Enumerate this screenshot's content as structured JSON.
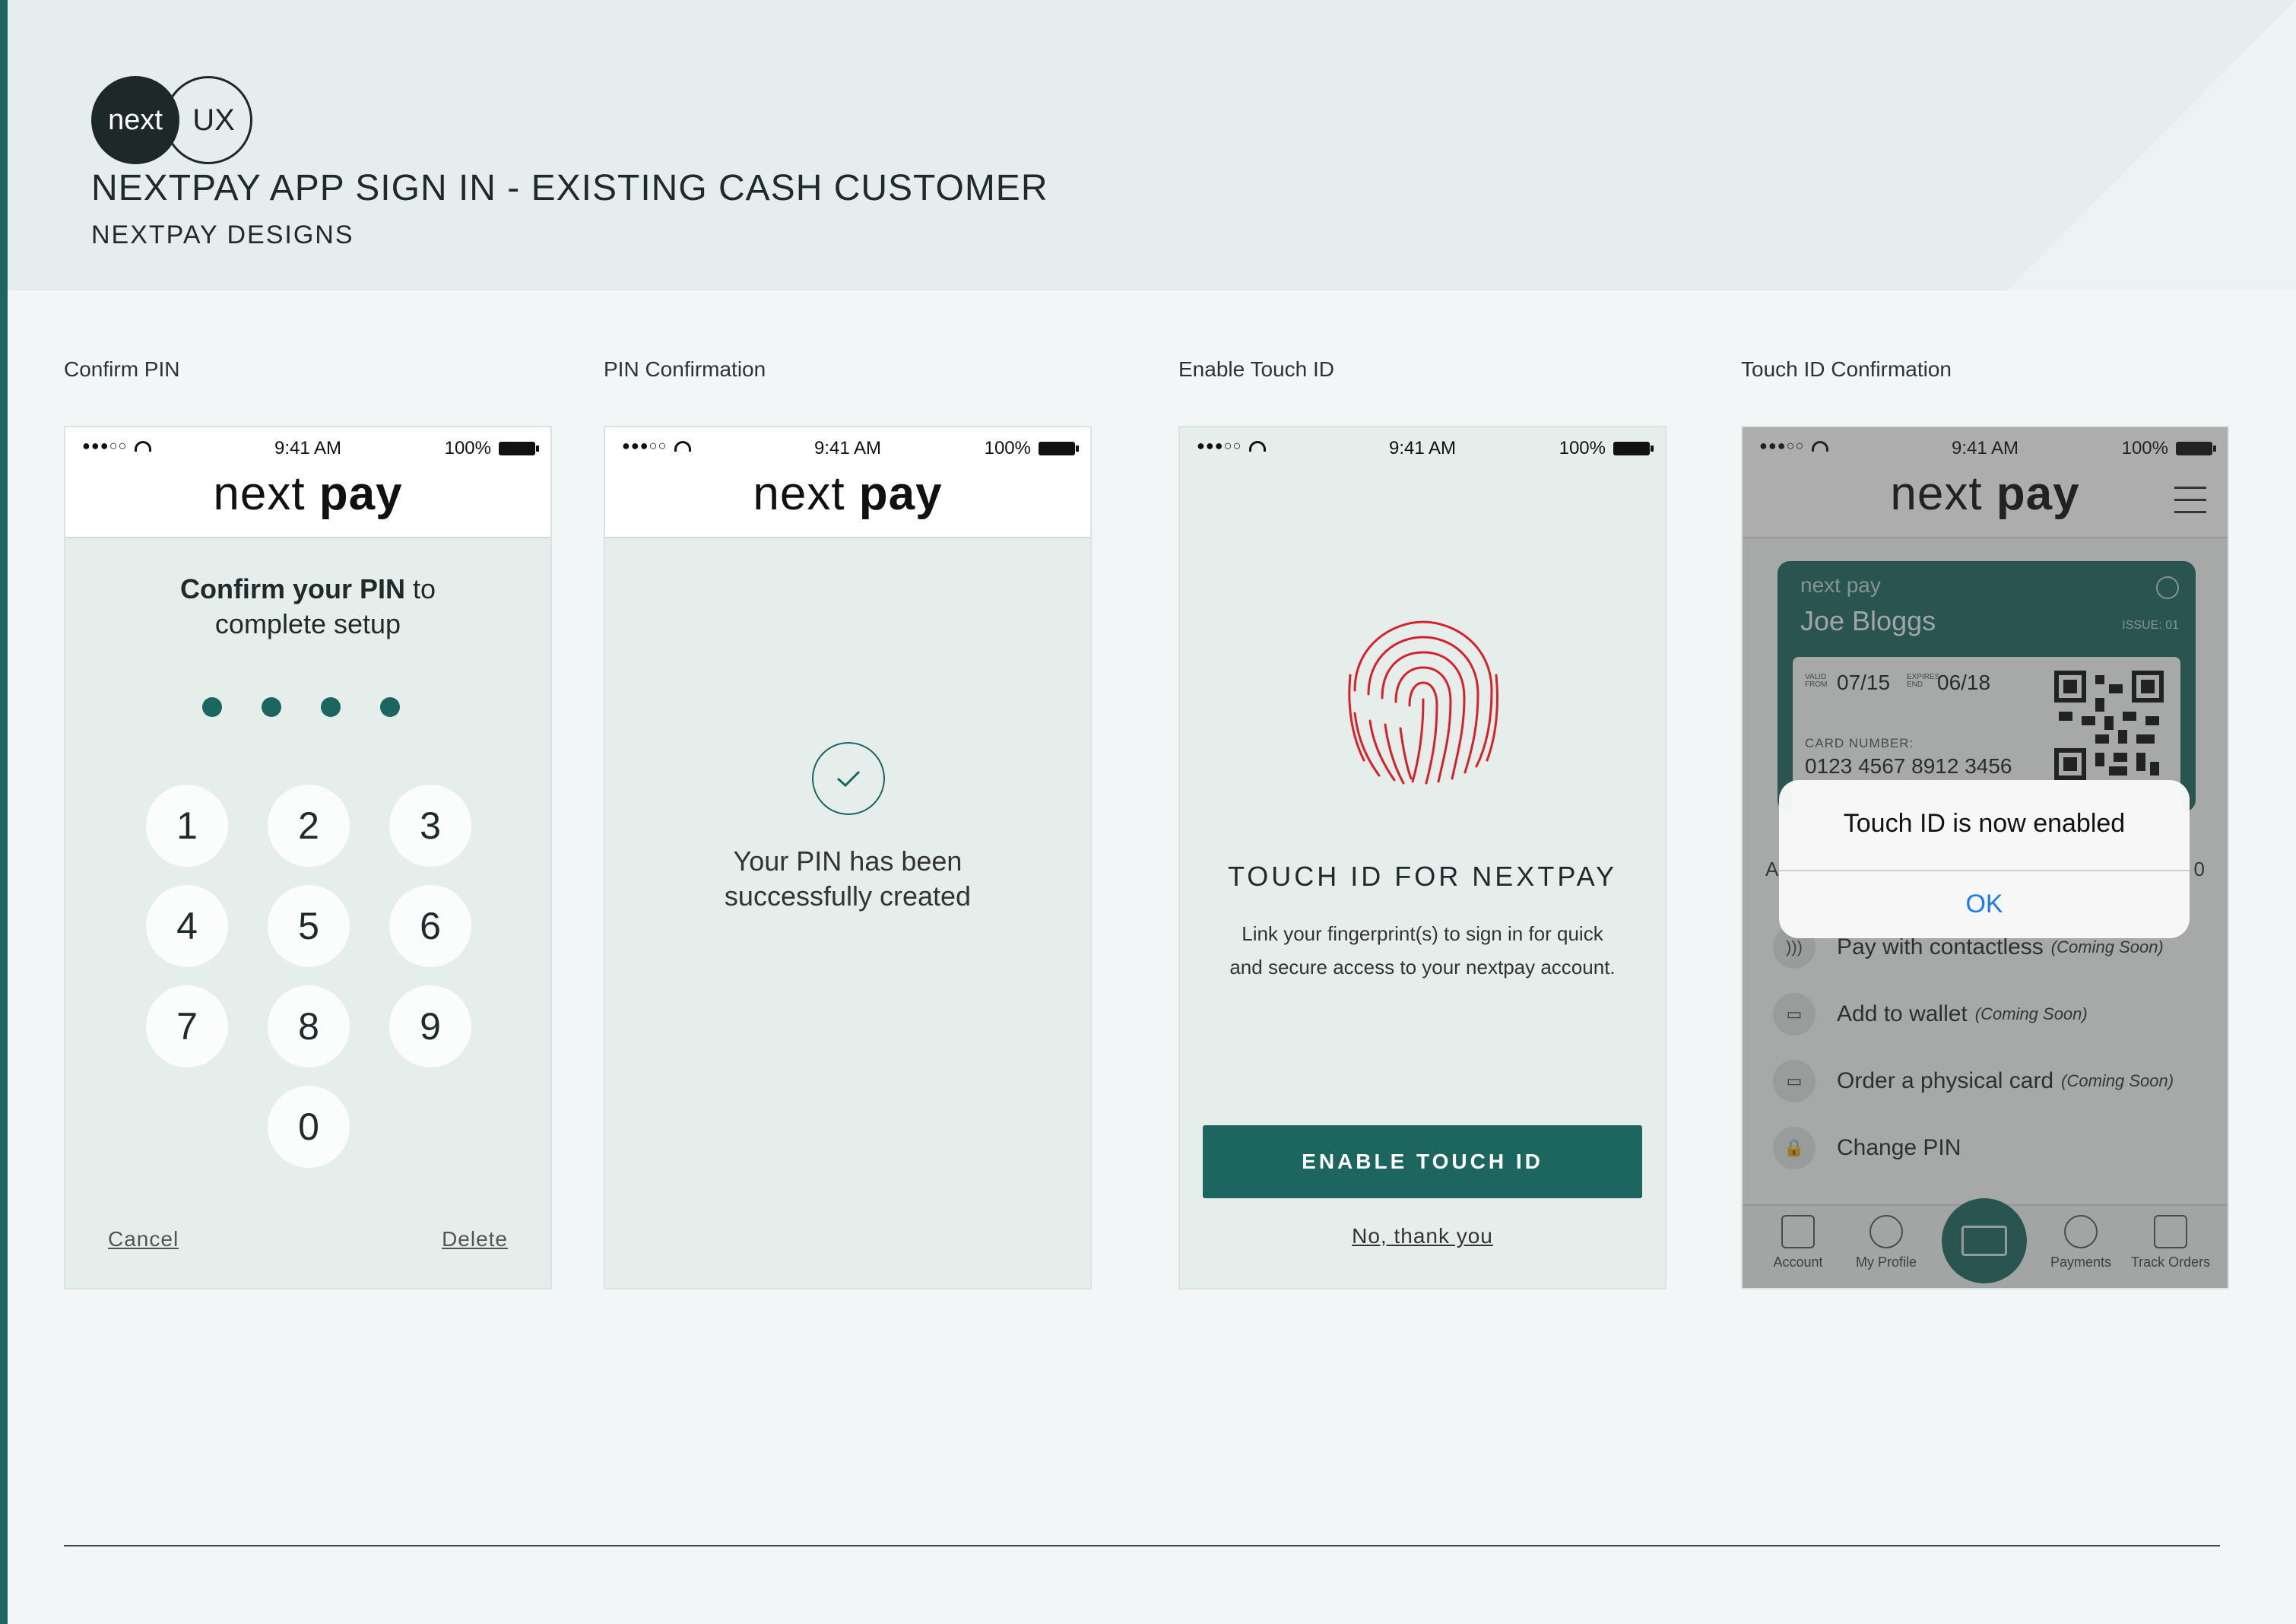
{
  "header": {
    "logo_left": "next",
    "logo_right": "UX",
    "title": "NEXTPAY APP SIGN IN - EXISTING CASH CUSTOMER",
    "subtitle": "NEXTPAY DESIGNS"
  },
  "status_bar": {
    "signal": "●●●○○",
    "time": "9:41 AM",
    "battery": "100%"
  },
  "brand": {
    "part1": "next",
    "part2": "pay"
  },
  "screens": [
    {
      "label": "Confirm PIN",
      "heading_bold": "Confirm your PIN",
      "heading_rest": " to",
      "heading_line2": "complete setup",
      "keys": [
        "1",
        "2",
        "3",
        "4",
        "5",
        "6",
        "7",
        "8",
        "9",
        "0"
      ],
      "cancel": "Cancel",
      "delete": "Delete"
    },
    {
      "label": "PIN Confirmation",
      "line1": "Your PIN has been",
      "line2": "successfully created"
    },
    {
      "label": "Enable Touch ID",
      "title": "TOUCH ID FOR NEXTPAY",
      "description": "Link your fingerprint(s) to sign in for quick and secure access to your nextpay account.",
      "button": "ENABLE TOUCH ID",
      "decline": "No, thank you"
    },
    {
      "label": "Touch ID Confirmation",
      "card": {
        "brand": "next pay",
        "name": "Joe Bloggs",
        "issue": "ISSUE: 01",
        "valid_from_label": "VALID FROM",
        "valid_from": "07/15",
        "expires_label": "EXPIRES END",
        "expires": "06/18",
        "number_label": "CARD NUMBER:",
        "number": "0123 4567 8912 3456"
      },
      "options": [
        {
          "label": "Pay with contactless",
          "note": "(Coming Soon)",
          "icon": "contactless-icon"
        },
        {
          "label": "Add to wallet",
          "note": "(Coming Soon)",
          "icon": "wallet-icon"
        },
        {
          "label": "Order a physical card",
          "note": "(Coming Soon)",
          "icon": "card-icon"
        },
        {
          "label": "Change PIN",
          "note": "",
          "icon": "lock-icon"
        }
      ],
      "tabs": [
        "Account",
        "My Profile",
        "Payments",
        "Track Orders"
      ],
      "side_left": "A",
      "side_right": "0",
      "alert": {
        "message": "Touch ID is now enabled",
        "ok": "OK"
      }
    }
  ],
  "colors": {
    "accent": "#1d6660",
    "fingerprint": "#d8202a",
    "ios_blue": "#1a7cf5"
  }
}
